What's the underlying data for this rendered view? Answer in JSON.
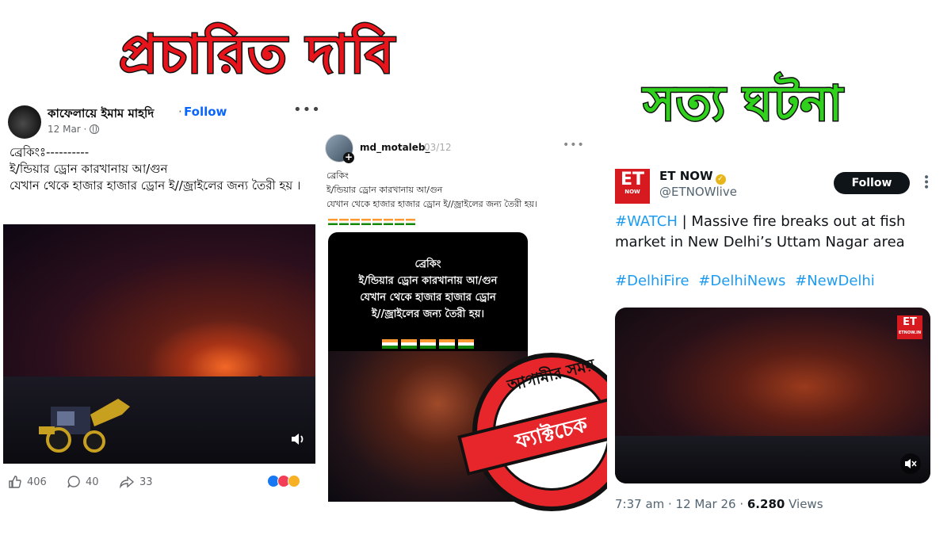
{
  "headlines": {
    "claim": "প্রচারিত দাবি",
    "fact": "সত্য ঘটনা"
  },
  "facebook_post": {
    "author": "কাফেলায়ে ইমাম মাহদি",
    "separator": "·",
    "follow_label": "Follow",
    "more": "•••",
    "date": "12 Mar ·",
    "text_lines": [
      "ব্রেকিংঃ----------",
      "ই/ন্ডিয়ার ড্রোন কারখানায় আ/গুন",
      "যেখান থেকে হাজার হাজার ড্রোন ই//জ্রাইলের জন্য তৈরী হয় ।"
    ],
    "likes": "406",
    "comments": "40",
    "shares": "33"
  },
  "middle_post": {
    "username": "md_motaleb_",
    "date": "03/12",
    "more": "•••",
    "text_lines": [
      "ব্রেকিং",
      "ই/ন্ডিয়ার ড্রোন কারখানায় আ/গুন",
      "যেখান থেকে হাজার হাজার ড্রোন ই//জ্রাইলের জন্য তৈরী হয়।"
    ],
    "video_caption_lines": [
      "ব্রেকিং",
      "ই/ন্ডিয়ার ড্রোন কারখানায় আ/গুন",
      "যেখান থেকে হাজার হাজার ড্রোন",
      "ই//জ্রাইলের জন্য তৈরী হয়।"
    ]
  },
  "stamp": {
    "top_text": "আগামীর সময়",
    "band_text": "ফ্যাক্টচেক"
  },
  "tweet": {
    "logo_big": "ET",
    "logo_small": "NOW",
    "name": "ET NOW",
    "handle": "@ETNOWlive",
    "follow_label": "Follow",
    "watch_tag": "#WATCH",
    "text": " | Massive fire breaks out at fish market in New Delhi’s Uttam Nagar area",
    "hashtags": [
      "#DelhiFire",
      "#DelhiNews",
      "#NewDelhi"
    ],
    "watermark_big": "ET",
    "watermark_small": "ETNOW.IN",
    "time": "7:37 am · 12 Mar 26 · ",
    "views_count": "6.280",
    "views_label": " Views"
  }
}
